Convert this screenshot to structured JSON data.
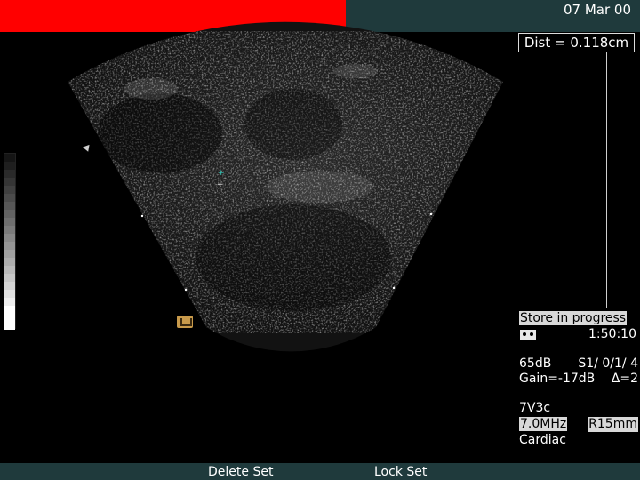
{
  "header": {
    "date": "07 Mar 00"
  },
  "measurement": {
    "label": "Dist = 0.118cm"
  },
  "status": {
    "store_text": "Store in progress",
    "tape_time": "1:50:10"
  },
  "settings": {
    "dynamic_range": "65dB",
    "preset_code": "S1/ 0/1/ 4",
    "gain": "Gain=-17dB",
    "delta": "Δ=2"
  },
  "probe": {
    "model": "7V3c",
    "frequency": "7.0MHz",
    "range": "R15mm",
    "application": "Cardiac"
  },
  "softkeys": {
    "delete": "Delete Set",
    "lock": "Lock Set"
  },
  "colors": {
    "header_red": "#ff0000",
    "bar_teal": "#1f3a3c",
    "icon_amber": "#c89a4b"
  }
}
